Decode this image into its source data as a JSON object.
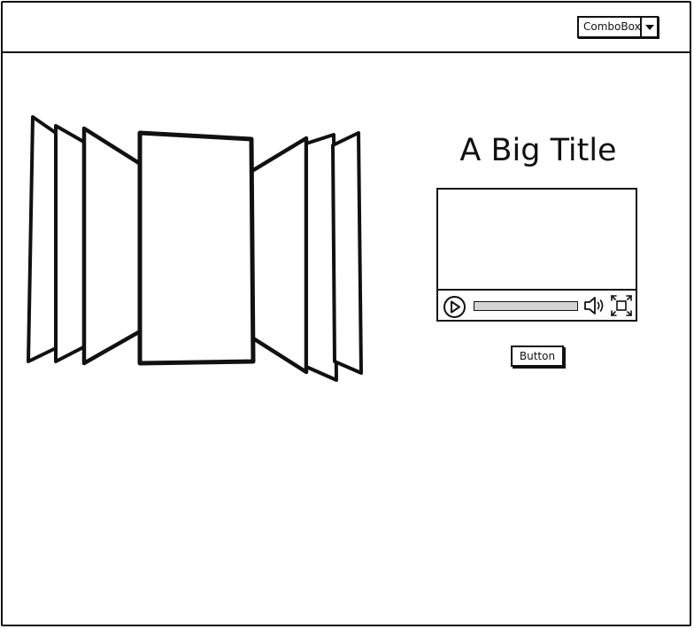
{
  "header": {
    "combobox": {
      "selected": "ComboBox"
    }
  },
  "main": {
    "title": "A Big Title",
    "button_label": "Button"
  },
  "icons": {
    "dropdown": "chevron-down-icon",
    "play": "play-icon",
    "volume": "volume-icon",
    "fullscreen": "fullscreen-icon"
  },
  "colors": {
    "stroke": "#111111",
    "progress_track": "#d4d4d4",
    "background": "#ffffff"
  }
}
